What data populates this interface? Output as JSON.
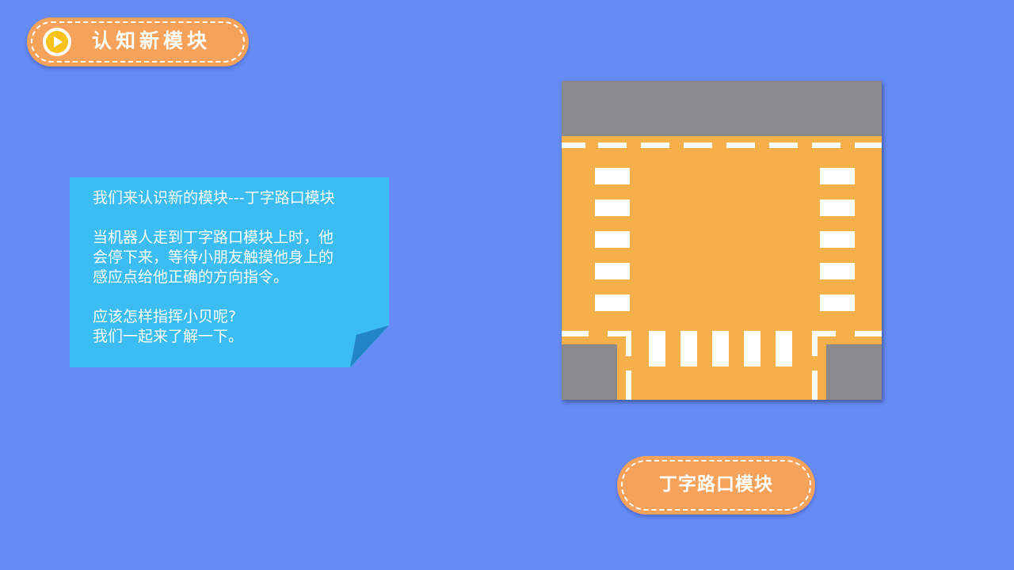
{
  "header": {
    "title": "认知新模块",
    "icon": "play-icon"
  },
  "note": {
    "line1": "我们来认识新的模块---丁字路口模块",
    "para2_line1": "当机器人走到丁字路口模块上时，他",
    "para2_line2": "会停下来，等待小朋友触摸他身上的",
    "para2_line3": "感应点给他正确的方向指令。",
    "para3_line1": "应该怎样指挥小贝呢?",
    "para3_line2": "我们一起来了解一下。"
  },
  "module_label": "丁字路口模块",
  "colors": {
    "background": "#658bf5",
    "pill": "#f7a25b",
    "note": "#3bbcf2",
    "road": "#f5b04a",
    "asphalt": "#8a898b"
  }
}
